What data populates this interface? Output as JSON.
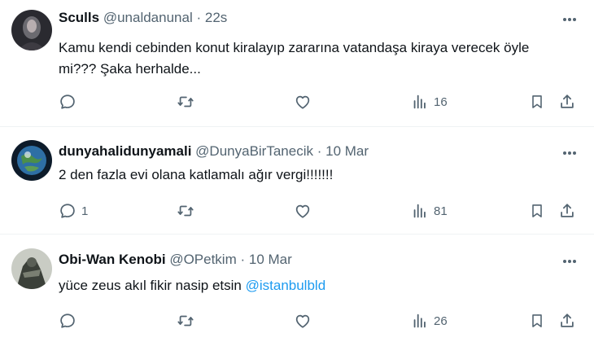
{
  "tweets": [
    {
      "name": "Sculls",
      "handle": "@unaldanunal",
      "separator": "·",
      "time": "22s",
      "text": "Kamu kendi cebinden konut kiralayıp zararına vatandaşa kiraya verecek öyle mi??? Şaka herhalde...",
      "mention": "",
      "replies": "",
      "views": "16"
    },
    {
      "name": "dunyahalidunyamali",
      "handle": "@DunyaBirTanecik",
      "separator": "·",
      "time": "10 Mar",
      "text": "2 den fazla evi olana katlamalı ağır vergi!!!!!!!",
      "mention": "",
      "replies": "1",
      "views": "81"
    },
    {
      "name": "Obi-Wan Kenobi",
      "handle": "@OPetkim",
      "separator": "·",
      "time": "10 Mar",
      "text": "yüce zeus akıl fikir nasip etsin ",
      "mention": "@istanbulbld",
      "replies": "",
      "views": "26"
    }
  ],
  "icons": {
    "reply": "reply-icon",
    "retweet": "retweet-icon",
    "like": "heart-icon",
    "views": "views-chart-icon",
    "bookmark": "bookmark-icon",
    "share": "share-icon",
    "more": "more-dots-icon"
  },
  "colors": {
    "text": "#0f1419",
    "secondary": "#536471",
    "link": "#1d9bf0",
    "divider": "#eff3f4"
  }
}
